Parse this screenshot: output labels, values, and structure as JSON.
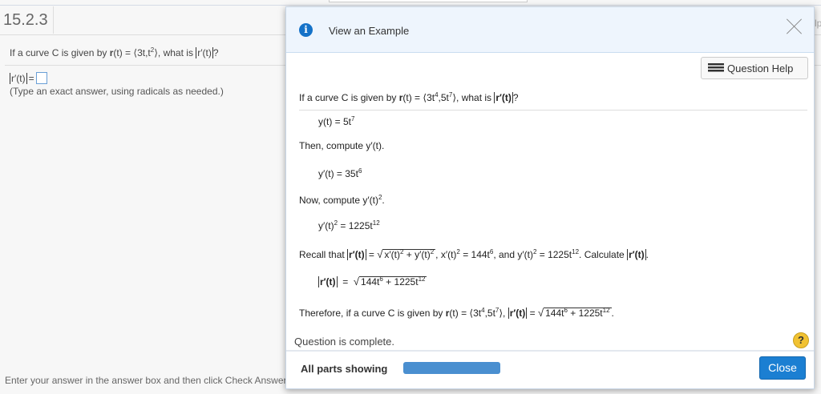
{
  "question_number": "15.2.3",
  "question": {
    "prefix": "If a curve C is given by ",
    "r": "r",
    "of_t_eq": "(t) = ",
    "open": "⟨",
    "v1": "3t,t",
    "e1": "2",
    "close": "⟩",
    "what": ", what is ",
    "rp": "r′(t)",
    "end": "?"
  },
  "answer": {
    "label": "r′(t)",
    "eq": " =",
    "hint": "(Type an exact answer, using radicals as needed.)"
  },
  "footer_text": "Enter your answer in the answer box and then click Check Answer.",
  "side_fragment": "lp",
  "modal": {
    "title": "View an Example",
    "question_help": "Question Help",
    "q": {
      "prefix": "If a curve C is given by ",
      "r": "r",
      "t": "(t) = ⟨3t",
      "e1": "4",
      "m": ",5t",
      "e2": "7",
      "c": "⟩, what is ",
      "rp": "r′(t)",
      "end": "?"
    },
    "l1": {
      "a": "y(t) = 5t",
      "e": "7"
    },
    "l2": "Then, compute y′(t).",
    "l3": {
      "a": "y′(t) = 35t",
      "e": "6"
    },
    "l4": {
      "a": "Now, compute y′(t)",
      "e": "2",
      "b": "."
    },
    "l5": {
      "a": "y′(t)",
      "e": "2",
      "b": " = 1225t",
      "e2": "12"
    },
    "l6": {
      "a": "Recall that ",
      "rp": "r′(t)",
      "b": " = ",
      "s1": "x′(t)",
      "s1e": "2",
      "s2": " + y′(t)",
      "s2e": "2",
      "c": ", x′(t)",
      "ce": "2",
      "d": " = 144t",
      "de": "6",
      "f": ", and y′(t)",
      "fe": "2",
      "g": " = 1225t",
      "ge": "12",
      "h": ". Calculate ",
      "rp2": "r′(t)",
      "i": "."
    },
    "l7": {
      "rp": "r′(t)",
      "eq": "  =  ",
      "s": "144t",
      "se": "6",
      "s2": " + 1225t",
      "s2e": "12"
    },
    "l8": {
      "a": "Therefore, if a curve C is given by ",
      "r": "r",
      "t": "(t) = ⟨3t",
      "e1": "4",
      "m": ",5t",
      "e2": "7",
      "c": "⟩, ",
      "rp": "r′(t)",
      "eq": " = ",
      "s": "144t",
      "se": "6",
      "s2": " + 1225t",
      "s2e": "12",
      "end": "."
    },
    "status": "Question is complete.",
    "help_symbol": "?",
    "parts_label": "All parts showing",
    "progress": 1.0,
    "close": "Close"
  },
  "colors": {
    "accent": "#1b7fd2",
    "progress": "#4a8fd0",
    "help": "#f1c232"
  }
}
